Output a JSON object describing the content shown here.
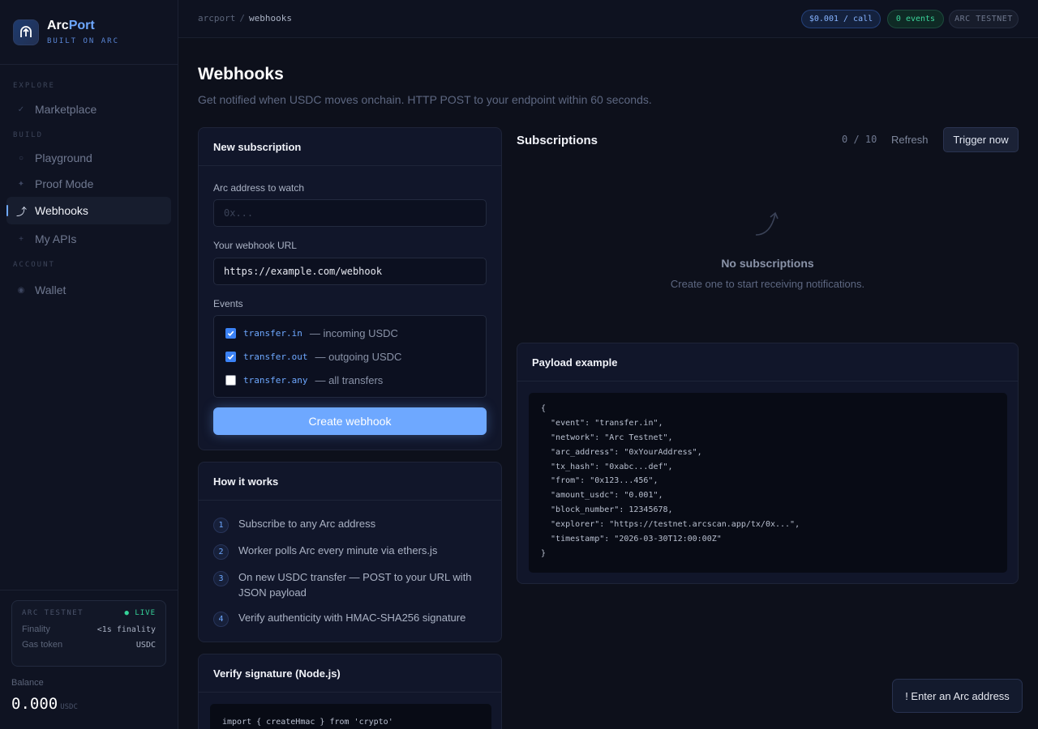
{
  "brand": {
    "name_part1": "Arc",
    "name_part2": "Port",
    "tagline": "BUILT ON ARC"
  },
  "sidebar": {
    "sections": {
      "explore": "EXPLORE",
      "build": "BUILD",
      "account": "ACCOUNT"
    },
    "items": [
      {
        "label": "Marketplace",
        "icon": "check-icon"
      },
      {
        "label": "Playground",
        "icon": "circle-icon"
      },
      {
        "label": "Proof Mode",
        "icon": "sparkle-icon"
      },
      {
        "label": "Webhooks",
        "icon": "arrow-curve-icon",
        "active": true
      },
      {
        "label": "My APIs",
        "icon": "plus-icon"
      },
      {
        "label": "Wallet",
        "icon": "dot-icon"
      }
    ],
    "network": {
      "title": "ARC TESTNET",
      "status": "● LIVE",
      "finality_label": "Finality",
      "finality_value": "<1s finality",
      "gas_label": "Gas token",
      "gas_value": "USDC"
    },
    "balance": {
      "label": "Balance",
      "value": "0.000",
      "unit": "USDC"
    }
  },
  "topbar": {
    "breadcrumb": {
      "root": "arcport",
      "separator": "/",
      "current": "webhooks"
    },
    "price_pill": "$0.001 / call",
    "events_pill": "0 events",
    "network_pill": "ARC TESTNET"
  },
  "header": {
    "title": "Webhooks",
    "subtitle": "Get notified when USDC moves onchain. HTTP POST to your endpoint within 60 seconds."
  },
  "new_subscription": {
    "title": "New subscription",
    "address_label": "Arc address to watch",
    "address_placeholder": "0x...",
    "url_label": "Your webhook URL",
    "url_value": "https://example.com/webhook",
    "events_label": "Events",
    "events": [
      {
        "code": "transfer.in",
        "desc": "— incoming USDC",
        "checked": true
      },
      {
        "code": "transfer.out",
        "desc": "— outgoing USDC",
        "checked": true
      },
      {
        "code": "transfer.any",
        "desc": "— all transfers",
        "checked": false
      }
    ],
    "create_label": "Create webhook"
  },
  "how_it_works": {
    "title": "How it works",
    "steps": [
      {
        "num": "1",
        "text": "Subscribe to any Arc address"
      },
      {
        "num": "2",
        "text": "Worker polls Arc every minute via ethers.js"
      },
      {
        "num": "3",
        "text": "On new USDC transfer — POST to your URL with JSON payload"
      },
      {
        "num": "4",
        "text": "Verify authenticity with HMAC-SHA256 signature"
      }
    ]
  },
  "verify": {
    "title": "Verify signature (Node.js)",
    "code_first_line": "import { createHmac } from 'crypto'"
  },
  "subscriptions": {
    "title": "Subscriptions",
    "count": "0 / 10",
    "refresh_label": "Refresh",
    "trigger_label": "Trigger now",
    "empty_title": "No subscriptions",
    "empty_sub": "Create one to start receiving notifications."
  },
  "payload": {
    "title": "Payload example",
    "lines": [
      "{",
      "  \"event\": \"transfer.in\",",
      "  \"network\": \"Arc Testnet\",",
      "  \"arc_address\": \"0xYourAddress\",",
      "  \"tx_hash\": \"0xabc...def\",",
      "  \"from\": \"0x123...456\",",
      "  \"amount_usdc\": \"0.001\",",
      "  \"block_number\": 12345678,",
      "  \"explorer\": \"https://testnet.arcscan.app/tx/0x...\",",
      "  \"timestamp\": \"2026-03-30T12:00:00Z\"",
      "}"
    ]
  },
  "toast": {
    "text": "! Enter an Arc address"
  }
}
